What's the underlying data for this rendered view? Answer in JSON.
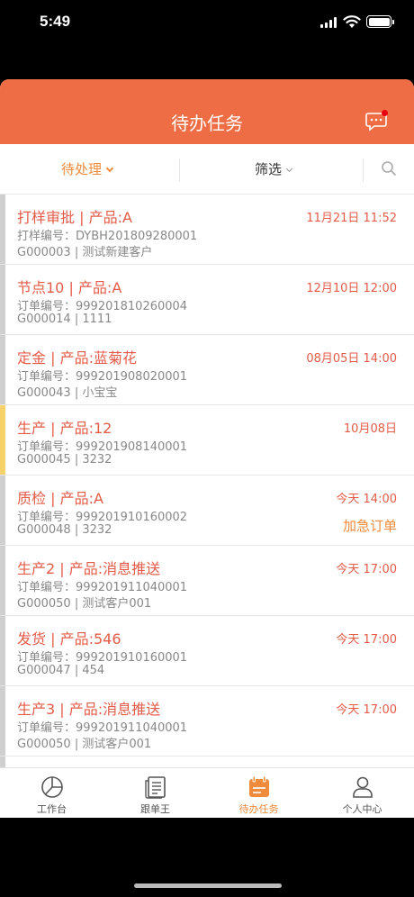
{
  "status": {
    "time": "5:49"
  },
  "header": {
    "title": "待办任务"
  },
  "filter": {
    "status_label": "待处理",
    "screen_label": "筛选"
  },
  "tasks": [
    {
      "title": "打样审批 | 产品:A",
      "time": "11月21日 11:52",
      "line1": "打样编号：DYBH201809280001",
      "line2": "G000003 | 测试新建客户",
      "tag": ""
    },
    {
      "title": "节点10 | 产品:A",
      "time": "12月10日 12:00",
      "line1": "订单编号：999201810260004",
      "line2": "G000014 | 1111",
      "tag": ""
    },
    {
      "title": "定金 | 产品:蓝菊花",
      "time": "08月05日 14:00",
      "line1": "订单编号：999201908020001",
      "line2": "G000043 | 小宝宝",
      "tag": ""
    },
    {
      "title": "生产 | 产品:12",
      "time": "10月08日",
      "line1": "订单编号：999201908140001",
      "line2": "G000045 | 3232",
      "tag": ""
    },
    {
      "title": "质检 | 产品:A",
      "time": "今天 14:00",
      "line1": "订单编号：999201910160002",
      "line2": "G000048 | 3232",
      "tag": "加急订单"
    },
    {
      "title": "生产2 | 产品:消息推送",
      "time": "今天 17:00",
      "line1": "订单编号：999201911040001",
      "line2": "G000050 | 测试客户001",
      "tag": ""
    },
    {
      "title": "发货 | 产品:546",
      "time": "今天 17:00",
      "line1": "订单编号：999201910160001",
      "line2": "G000047 | 454",
      "tag": ""
    },
    {
      "title": "生产3 | 产品:消息推送",
      "time": "今天 17:00",
      "line1": "订单编号：999201911040001",
      "line2": "G000050 | 测试客户001",
      "tag": ""
    }
  ],
  "tabs": [
    {
      "label": "工作台",
      "icon": "pie-chart-icon"
    },
    {
      "label": "跟单王",
      "icon": "document-list-icon"
    },
    {
      "label": "待办任务",
      "icon": "calendar-icon"
    },
    {
      "label": "个人中心",
      "icon": "user-icon"
    }
  ],
  "colors": {
    "accent": "#ee6d45",
    "alert_text": "#e45b48",
    "tab_active": "#f08a3c",
    "side_yellow": "#f7d26a"
  }
}
